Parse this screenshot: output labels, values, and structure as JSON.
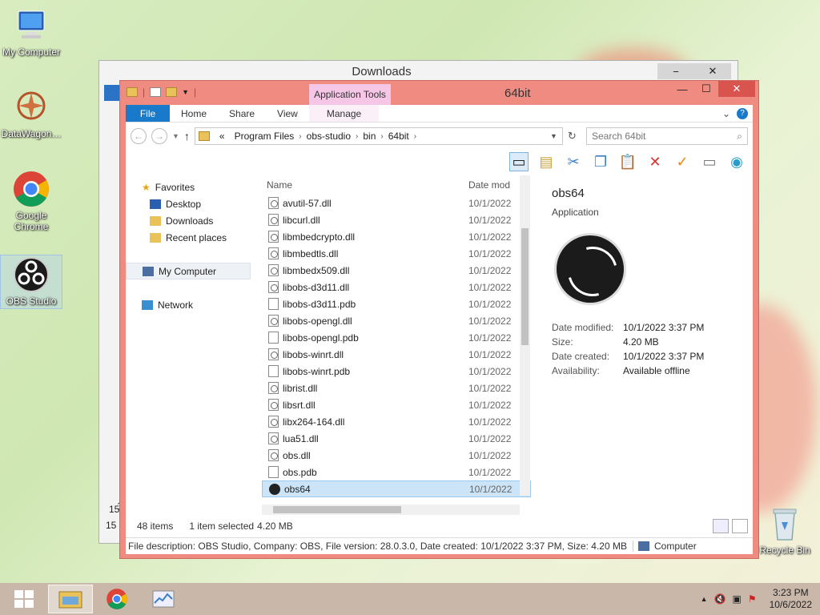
{
  "desktop": {
    "icons": [
      {
        "label": "My Computer",
        "name": "my-computer"
      },
      {
        "label": "DataWagon…",
        "name": "datawagon"
      },
      {
        "label": "Google Chrome",
        "name": "google-chrome"
      },
      {
        "label": "OBS Studio",
        "name": "obs-studio"
      },
      {
        "label": "Recycle Bin",
        "name": "recycle-bin"
      }
    ]
  },
  "back_window": {
    "title": "Downloads",
    "side_numbers": [
      "15",
      "1",
      "15"
    ]
  },
  "window": {
    "title": "64bit",
    "app_tools": "Application Tools",
    "ribbon_tabs": [
      "File",
      "Home",
      "Share",
      "View",
      "Manage"
    ],
    "address": {
      "crumbs": [
        "«",
        "Program Files",
        "obs-studio",
        "bin",
        "64bit"
      ],
      "search_placeholder": "Search 64bit"
    },
    "nav": {
      "favorites": "Favorites",
      "items": [
        "Desktop",
        "Downloads",
        "Recent places"
      ],
      "my_computer": "My Computer",
      "network": "Network"
    },
    "columns": {
      "name": "Name",
      "date": "Date mod"
    },
    "files": [
      {
        "name": "avutil-57.dll",
        "date": "10/1/2022",
        "kind": "dll"
      },
      {
        "name": "libcurl.dll",
        "date": "10/1/2022",
        "kind": "dll"
      },
      {
        "name": "libmbedcrypto.dll",
        "date": "10/1/2022",
        "kind": "dll"
      },
      {
        "name": "libmbedtls.dll",
        "date": "10/1/2022",
        "kind": "dll"
      },
      {
        "name": "libmbedx509.dll",
        "date": "10/1/2022",
        "kind": "dll"
      },
      {
        "name": "libobs-d3d11.dll",
        "date": "10/1/2022",
        "kind": "dll"
      },
      {
        "name": "libobs-d3d11.pdb",
        "date": "10/1/2022",
        "kind": "pdb"
      },
      {
        "name": "libobs-opengl.dll",
        "date": "10/1/2022",
        "kind": "dll"
      },
      {
        "name": "libobs-opengl.pdb",
        "date": "10/1/2022",
        "kind": "pdb"
      },
      {
        "name": "libobs-winrt.dll",
        "date": "10/1/2022",
        "kind": "dll"
      },
      {
        "name": "libobs-winrt.pdb",
        "date": "10/1/2022",
        "kind": "pdb"
      },
      {
        "name": "librist.dll",
        "date": "10/1/2022",
        "kind": "dll"
      },
      {
        "name": "libsrt.dll",
        "date": "10/1/2022",
        "kind": "dll"
      },
      {
        "name": "libx264-164.dll",
        "date": "10/1/2022",
        "kind": "dll"
      },
      {
        "name": "lua51.dll",
        "date": "10/1/2022",
        "kind": "dll"
      },
      {
        "name": "obs.dll",
        "date": "10/1/2022",
        "kind": "dll"
      },
      {
        "name": "obs.pdb",
        "date": "10/1/2022",
        "kind": "pdb"
      },
      {
        "name": "obs64",
        "date": "10/1/2022",
        "kind": "exe",
        "selected": true
      }
    ],
    "details": {
      "name": "obs64",
      "type": "Application",
      "rows": [
        {
          "k": "Date modified:",
          "v": "10/1/2022 3:37 PM"
        },
        {
          "k": "Size:",
          "v": "4.20 MB"
        },
        {
          "k": "Date created:",
          "v": "10/1/2022 3:37 PM"
        },
        {
          "k": "Availability:",
          "v": "Available offline"
        }
      ]
    },
    "status": {
      "count": "48 items",
      "selected": "1 item selected",
      "size": "4.20 MB"
    },
    "description": "File description: OBS Studio, Company: OBS, File version: 28.0.3.0, Date created: 10/1/2022 3:37 PM, Size: 4.20 MB",
    "location": "Computer"
  },
  "taskbar": {
    "time": "3:23 PM",
    "date": "10/6/2022"
  },
  "colors": {
    "accent": "#1979ca",
    "frame": "#ef8b80",
    "app_tools": "#f6c6e6",
    "selection": "#cce4f7",
    "taskbar": "#c9b8a9"
  }
}
